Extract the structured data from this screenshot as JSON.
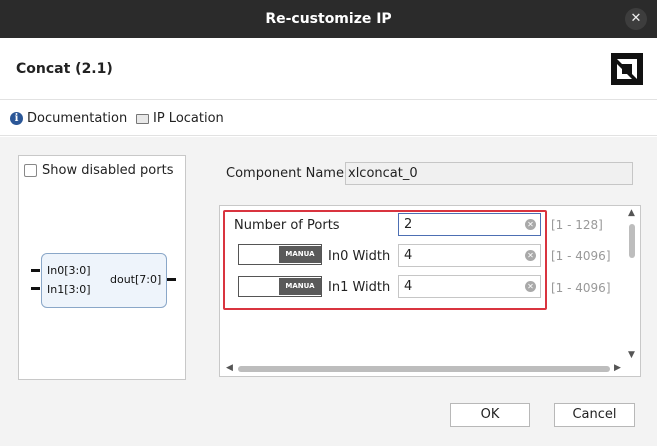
{
  "window": {
    "title": "Re-customize IP",
    "close_glyph": "✕"
  },
  "header": {
    "ip_title": "Concat (2.1)",
    "logo_icon": "amd-logo"
  },
  "links": {
    "documentation": "Documentation",
    "ip_location": "IP Location"
  },
  "symbol": {
    "show_disabled_ports": "Show disabled ports",
    "ports": {
      "in0": "In0[3:0]",
      "in1": "In1[3:0]",
      "dout": "dout[7:0]"
    }
  },
  "component": {
    "label": "Component Name",
    "value": "xlconcat_0"
  },
  "params": {
    "num_ports": {
      "label": "Number of Ports",
      "value": "2",
      "range": "[1 - 128]"
    },
    "in0_width": {
      "label": "In0 Width",
      "value": "4",
      "range": "[1 - 4096]",
      "toggle": "MANUA"
    },
    "in1_width": {
      "label": "In1 Width",
      "value": "4",
      "range": "[1 - 4096]",
      "toggle": "MANUA"
    }
  },
  "buttons": {
    "ok": "OK",
    "cancel": "Cancel"
  },
  "colors": {
    "titlebar": "#2b2b2b",
    "highlight": "#d9343f",
    "field_focus": "#4d6fb3"
  }
}
